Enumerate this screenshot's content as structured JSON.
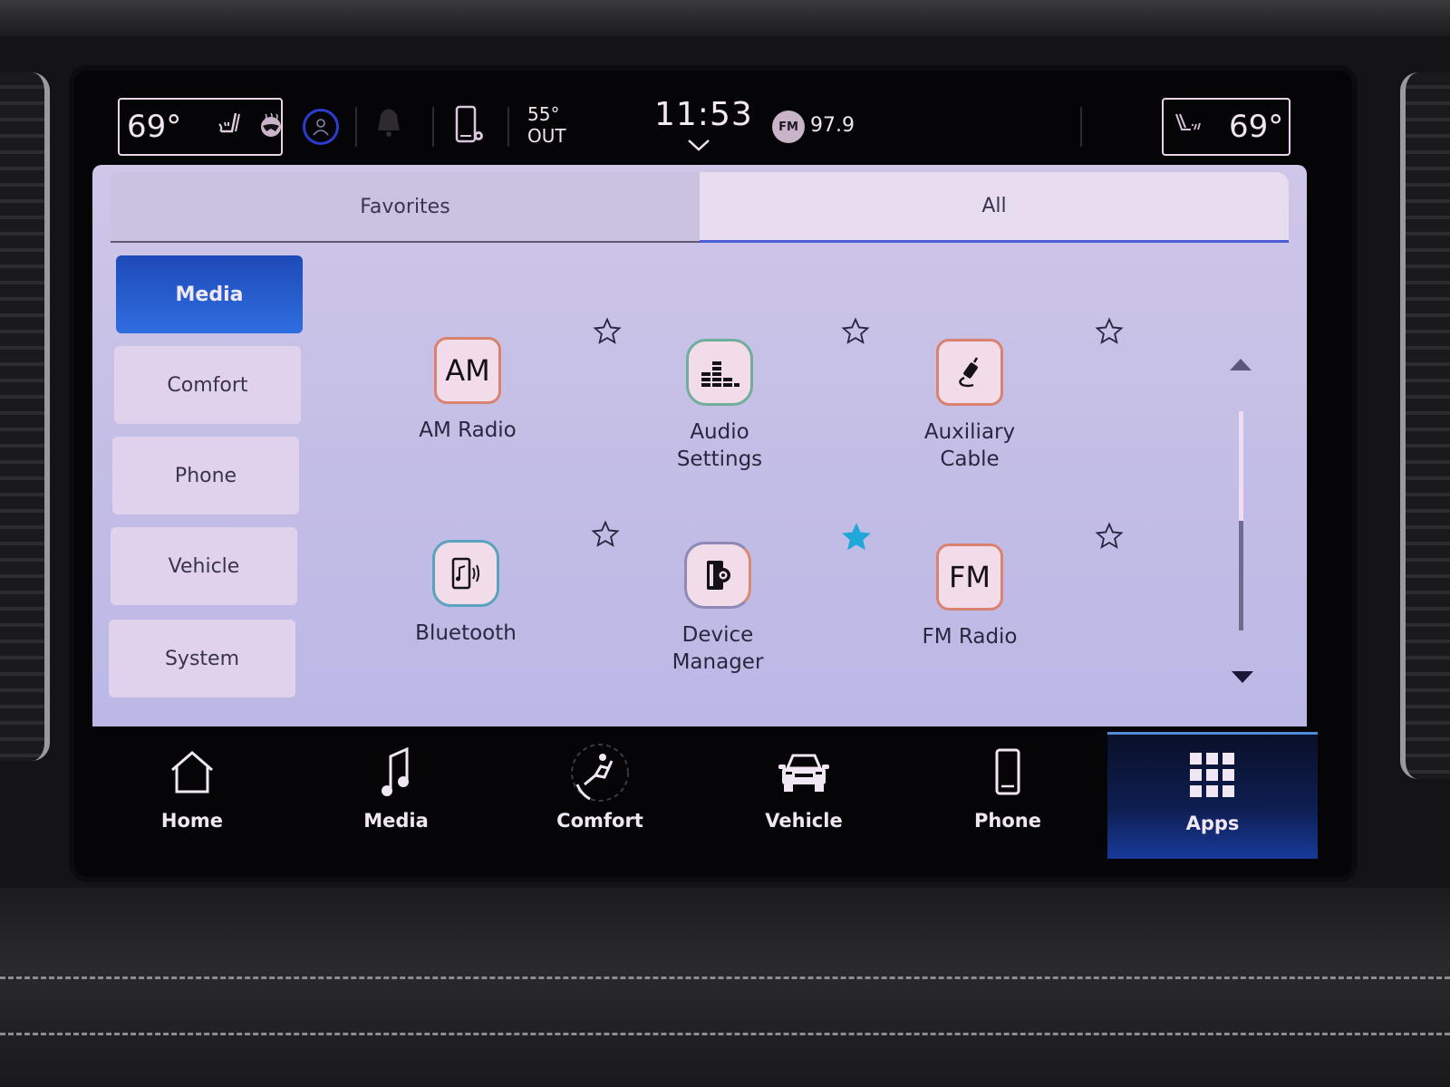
{
  "status_bar": {
    "driver_temp": "69°",
    "passenger_temp": "69°",
    "outside_temp_value": "55°",
    "outside_temp_label": "OUT",
    "clock": "11:53",
    "radio_band": "FM",
    "radio_frequency": "97.9"
  },
  "tabs": [
    {
      "label": "Favorites",
      "active": false
    },
    {
      "label": "All",
      "active": true
    }
  ],
  "categories": [
    {
      "label": "Media",
      "selected": true
    },
    {
      "label": "Comfort",
      "selected": false
    },
    {
      "label": "Phone",
      "selected": false
    },
    {
      "label": "Vehicle",
      "selected": false
    },
    {
      "label": "System",
      "selected": false
    }
  ],
  "apps": [
    {
      "label_line1": "AM Radio",
      "label_line2": "",
      "icon": "am-icon",
      "icon_text": "AM",
      "favorite": false
    },
    {
      "label_line1": "Audio",
      "label_line2": "Settings",
      "icon": "equalizer-icon",
      "icon_text": "",
      "favorite": false
    },
    {
      "label_line1": "Auxiliary",
      "label_line2": "Cable",
      "icon": "aux-cable-icon",
      "icon_text": "",
      "favorite": false
    },
    {
      "label_line1": "Bluetooth",
      "label_line2": "",
      "icon": "bluetooth-audio-icon",
      "icon_text": "",
      "favorite": false
    },
    {
      "label_line1": "Device",
      "label_line2": "Manager",
      "icon": "device-manager-icon",
      "icon_text": "",
      "favorite": true
    },
    {
      "label_line1": "FM Radio",
      "label_line2": "",
      "icon": "fm-icon",
      "icon_text": "FM",
      "favorite": false
    }
  ],
  "scroll": {
    "position_fraction": 0.0,
    "visible_fraction": 0.5
  },
  "dock": [
    {
      "label": "Home",
      "icon": "home-icon",
      "active": false
    },
    {
      "label": "Media",
      "icon": "music-note-icon",
      "active": false
    },
    {
      "label": "Comfort",
      "icon": "comfort-seat-icon",
      "active": false
    },
    {
      "label": "Vehicle",
      "icon": "car-icon",
      "active": false
    },
    {
      "label": "Phone",
      "icon": "phone-icon",
      "active": false
    },
    {
      "label": "Apps",
      "icon": "apps-grid-icon",
      "active": true
    }
  ],
  "colors": {
    "accent_blue": "#2f6ee0",
    "favorite_star": "#1fa8d8",
    "panel_bg": "#c6c0e6",
    "screen_bg": "#050507"
  }
}
